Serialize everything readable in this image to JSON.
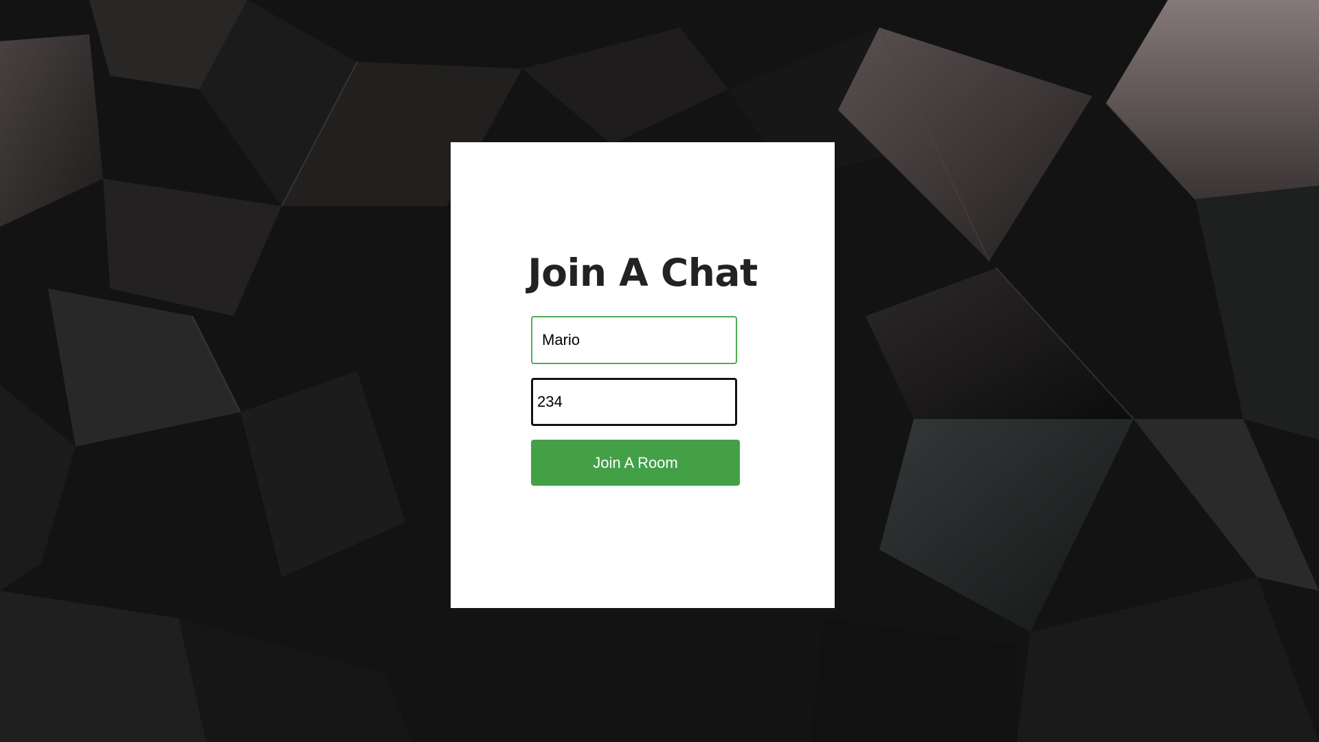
{
  "page": {
    "title": "Join A Chat"
  },
  "form": {
    "name_value": "Mario",
    "room_value": "234",
    "submit_label": "Join A Room"
  },
  "colors": {
    "background_dark": "#141414",
    "card": "#ffffff",
    "title_text": "#222222",
    "name_field_border": "#4caf50",
    "room_field_border": "#111111",
    "button": "#43a047",
    "button_text": "#ffffff"
  }
}
